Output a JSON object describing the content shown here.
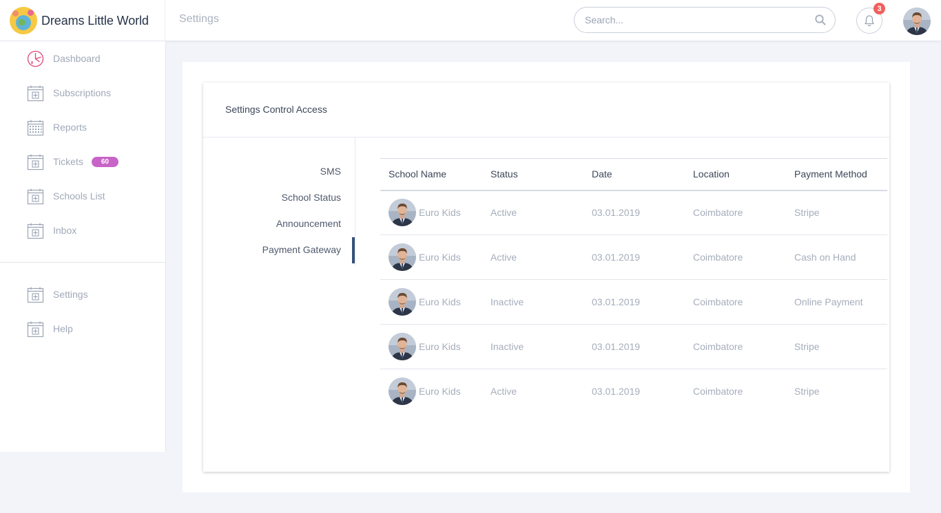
{
  "app": {
    "name": "Dreams Little World"
  },
  "header": {
    "page_title": "Settings",
    "search_placeholder": "Search...",
    "notification_count": "3"
  },
  "sidebar": {
    "items": [
      {
        "label": "Dashboard",
        "icon": "dashboard-icon"
      },
      {
        "label": "Subscriptions",
        "icon": "calendar-plus-icon"
      },
      {
        "label": "Reports",
        "icon": "calendar-grid-icon"
      },
      {
        "label": "Tickets",
        "icon": "calendar-plus-icon",
        "badge": "60"
      },
      {
        "label": "Schools List",
        "icon": "calendar-plus-icon"
      },
      {
        "label": "Inbox",
        "icon": "calendar-plus-icon"
      }
    ],
    "bottom_items": [
      {
        "label": "Settings",
        "icon": "calendar-plus-icon"
      },
      {
        "label": "Help",
        "icon": "calendar-plus-icon"
      }
    ]
  },
  "card": {
    "title": "Settings Control Access",
    "tabs": [
      "SMS",
      "School Status",
      "Announcement",
      "Payment Gateway"
    ],
    "active_tab": "Payment Gateway"
  },
  "table": {
    "columns": [
      "School Name",
      "Status",
      "Date",
      "Location",
      "Payment Method"
    ],
    "rows": [
      {
        "school": "Euro Kids",
        "status": "Active",
        "date": "03.01.2019",
        "location": "Coimbatore",
        "payment": "Stripe"
      },
      {
        "school": "Euro Kids",
        "status": "Active",
        "date": "03.01.2019",
        "location": "Coimbatore",
        "payment": "Cash on Hand"
      },
      {
        "school": "Euro Kids",
        "status": "Inactive",
        "date": "03.01.2019",
        "location": "Coimbatore",
        "payment": "Online Payment"
      },
      {
        "school": "Euro Kids",
        "status": "Inactive",
        "date": "03.01.2019",
        "location": "Coimbatore",
        "payment": "Stripe"
      },
      {
        "school": "Euro Kids",
        "status": "Active",
        "date": "03.01.2019",
        "location": "Coimbatore",
        "payment": "Stripe"
      }
    ]
  },
  "colors": {
    "accent": "#35507a",
    "badge_pink": "#c864c8",
    "notification_red": "#f0605d",
    "icon_pink": "#e0437c"
  }
}
